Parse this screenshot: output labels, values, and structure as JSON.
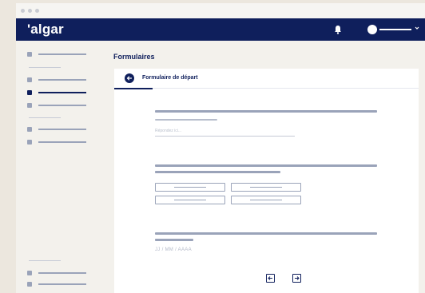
{
  "header": {
    "brand": "'algar",
    "icons": {
      "notifications": "bell-icon",
      "user_menu": "chevron-down-icon"
    }
  },
  "sidebar": {
    "items": [
      {
        "name": "sidebar-item-1",
        "active": false
      },
      {
        "name": "sidebar-item-2",
        "active": false
      },
      {
        "name": "sidebar-item-3",
        "active": true
      },
      {
        "name": "sidebar-item-4",
        "active": false
      },
      {
        "name": "sidebar-item-5",
        "active": false
      },
      {
        "name": "sidebar-item-6",
        "active": false
      },
      {
        "name": "sidebar-item-7",
        "active": false
      },
      {
        "name": "sidebar-item-8",
        "active": false
      }
    ]
  },
  "main": {
    "page_title": "Formulaires",
    "form_title": "Formulaire de départ",
    "answer_placeholder": "Répondez ici...",
    "date_placeholder": "JJ / MM / AAAA",
    "nav": {
      "prev_icon": "arrow-left-icon",
      "next_icon": "arrow-right-icon"
    }
  },
  "colors": {
    "brand_navy": "#0f1f5c",
    "skeleton_gray": "#9aa3b9",
    "page_background": "#ece7de"
  }
}
